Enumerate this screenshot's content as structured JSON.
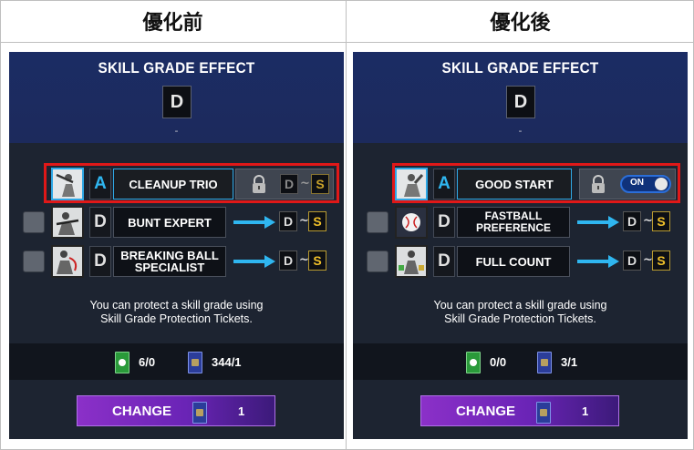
{
  "headers": {
    "before": "優化前",
    "after": "優化後"
  },
  "panels": [
    {
      "title": "SKILL GRADE EFFECT",
      "grade": "D",
      "subtext": "-",
      "skills": [
        {
          "checkbox": false,
          "grade": "A",
          "name": "CLEANUP TRIO",
          "name_lines": [
            "CLEANUP TRIO"
          ],
          "locked": true,
          "range_from": "D",
          "range_sep": "~",
          "range_to": "S",
          "highlighted": true,
          "icon": "batter-swing-icon"
        },
        {
          "checkbox": true,
          "grade": "D",
          "name": "BUNT EXPERT",
          "name_lines": [
            "BUNT EXPERT"
          ],
          "range_from": "D",
          "range_sep": "~",
          "range_to": "S",
          "icon": "bunt-icon"
        },
        {
          "checkbox": true,
          "grade": "D",
          "name": "BREAKING BALL SPECIALIST",
          "name_lines": [
            "BREAKING BALL",
            "SPECIALIST"
          ],
          "range_from": "D",
          "range_sep": "~",
          "range_to": "S",
          "icon": "breaking-ball-icon"
        }
      ],
      "info": [
        "You can protect a skill grade using",
        "Skill Grade Protection Tickets."
      ],
      "tickets": {
        "green_count": "6/0",
        "blue_count": "344/1"
      },
      "change": {
        "label": "CHANGE",
        "count": "1"
      }
    },
    {
      "title": "SKILL GRADE EFFECT",
      "grade": "D",
      "subtext": "-",
      "skills": [
        {
          "checkbox": false,
          "grade": "A",
          "name": "GOOD START",
          "name_lines": [
            "GOOD START"
          ],
          "toggle": "ON",
          "highlighted": true,
          "icon": "pitcher-icon"
        },
        {
          "checkbox": true,
          "grade": "D",
          "name": "FASTBALL PREFERENCE",
          "name_lines": [
            "FASTBALL PREFERENCE"
          ],
          "range_from": "D",
          "range_sep": "~",
          "range_to": "S",
          "icon": "fastball-icon"
        },
        {
          "checkbox": true,
          "grade": "D",
          "name": "FULL COUNT",
          "name_lines": [
            "FULL COUNT"
          ],
          "range_from": "D",
          "range_sep": "~",
          "range_to": "S",
          "icon": "full-count-icon"
        }
      ],
      "info": [
        "You can protect a skill grade using",
        "Skill Grade Protection Tickets."
      ],
      "tickets": {
        "green_count": "0/0",
        "blue_count": "3/1"
      },
      "change": {
        "label": "CHANGE",
        "count": "1"
      }
    }
  ],
  "colors": {
    "highlight": "#e01818",
    "accent": "#2fb6f0",
    "s_grade": "#f0c02a",
    "change_button": "#7a2cc0"
  }
}
